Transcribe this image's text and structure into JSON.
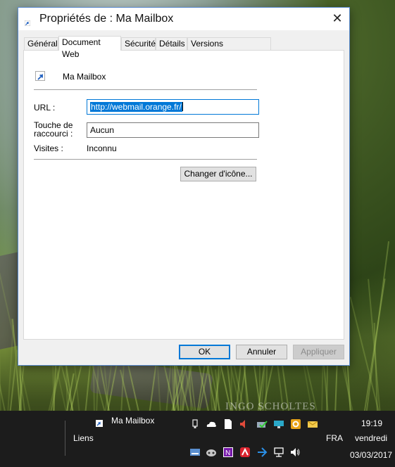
{
  "dialog": {
    "title": "Propriétés de : Ma Mailbox",
    "close_glyph": "✕",
    "tabs": [
      "Général",
      "Document Web",
      "Sécurité",
      "Détails",
      "Versions précédentes"
    ],
    "active_tab": "Document Web",
    "shortcut_name": "Ma Mailbox",
    "url_label": "URL :",
    "url_value": "http://webmail.orange.fr/",
    "shortcut_key_label_line1": "Touche de",
    "shortcut_key_label_line2": "raccourci :",
    "shortcut_key_value": "Aucun",
    "visits_label": "Visites :",
    "visits_value": "Inconnu",
    "change_icon_label": "Changer d'icône...",
    "ok_label": "OK",
    "cancel_label": "Annuler",
    "apply_label": "Appliquer"
  },
  "wallpaper": {
    "watermark": "INGO SCHOLTES"
  },
  "taskbar": {
    "pinned_shortcut": "Ma Mailbox",
    "links_label": "Liens",
    "language": "FRA",
    "time": "19:19",
    "day": "vendredi",
    "date": "03/03/2017",
    "tray_icons_row1": [
      "usb-icon",
      "onedrive-icon",
      "document-icon",
      "volume-muted-icon",
      "network-check-icon",
      "keyboard-icon",
      "outlook-icon",
      "mail-icon"
    ],
    "tray_icons_row2": [
      "storage-icon",
      "gamepad-icon",
      "onenote-icon",
      "antivirus-icon",
      "bluetooth-icon",
      "network-icon",
      "speaker-icon"
    ]
  },
  "colors": {
    "accent": "#0078d7",
    "taskbar": "#1c1c1c",
    "dialog_bg": "#f0f0f0"
  }
}
